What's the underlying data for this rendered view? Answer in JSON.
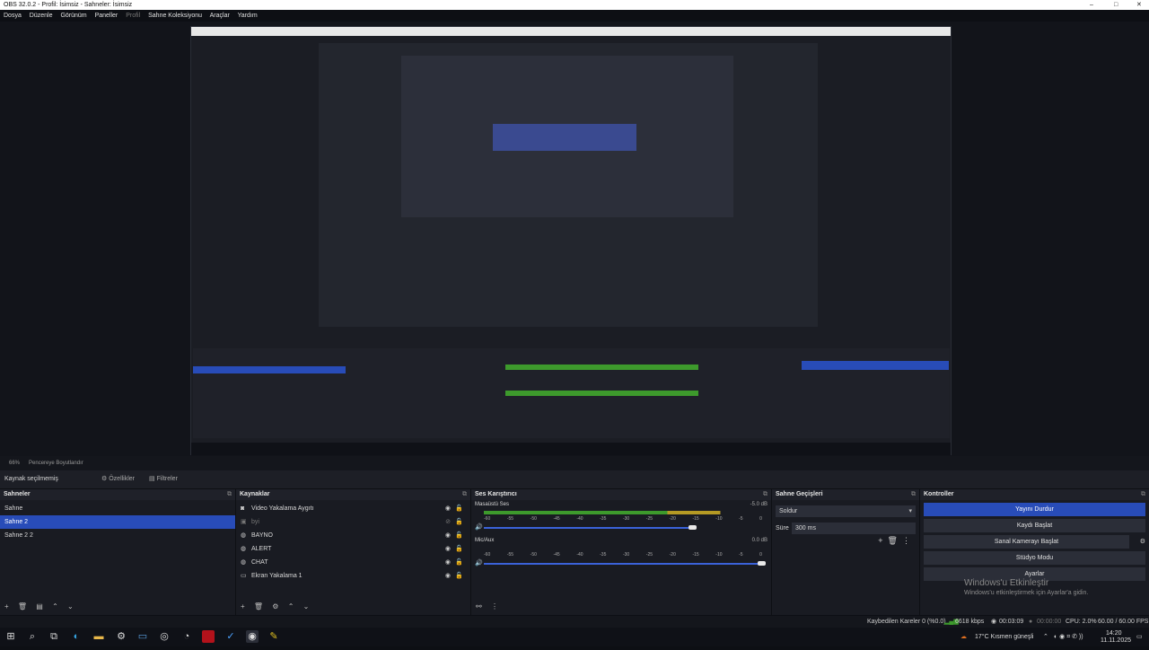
{
  "window": {
    "title": "OBS 32.0.2 - Profil: İsimsiz - Sahneler: İsimsiz",
    "controls": [
      "–",
      "□",
      "✕"
    ]
  },
  "menu": [
    "Dosya",
    "Düzenle",
    "Görünüm",
    "Paneller",
    "Profil",
    "Sahne Koleksiyonu",
    "Araçlar",
    "Yardım"
  ],
  "status_row": {
    "zoom": "66%",
    "mode": "Pencereye Boyutlandır"
  },
  "source_bar": {
    "selected": "Kaynak seçilmemiş",
    "properties": "Özellikler",
    "filters": "Filtreler"
  },
  "scenes": {
    "title": "Sahneler",
    "items": [
      "Sahne",
      "Sahne 2",
      "Sahne 2 2"
    ],
    "selected_index": 1,
    "footer_icons": [
      "+",
      "🗑",
      "▤",
      "⌃",
      "⌄"
    ]
  },
  "sources": {
    "title": "Kaynaklar",
    "items": [
      {
        "label": "Video Yakalama Aygıtı",
        "icon": "camera-icon",
        "visible": true
      },
      {
        "label": "byi",
        "icon": "image-icon",
        "visible": false
      },
      {
        "label": "BAYNO",
        "icon": "browser-icon",
        "visible": true
      },
      {
        "label": "ALERT",
        "icon": "browser-icon",
        "visible": true
      },
      {
        "label": "CHAT",
        "icon": "browser-icon",
        "visible": true
      },
      {
        "label": "Ekran Yakalama 1",
        "icon": "monitor-icon",
        "visible": true
      }
    ],
    "footer_icons": [
      "+",
      "🗑",
      "⚙",
      "⌃",
      "⌄"
    ]
  },
  "mixer": {
    "title": "Ses Karıştırıcı",
    "tracks": [
      {
        "name": "Masaüstü Ses",
        "db": "-5.0 dB",
        "level": 0.85,
        "volume": 0.75
      },
      {
        "name": "Mic/Aux",
        "db": "0.0 dB",
        "level": 0.0,
        "volume": 1.0
      }
    ],
    "ticks": [
      "-60",
      "-55",
      "-50",
      "-45",
      "-40",
      "-35",
      "-30",
      "-25",
      "-20",
      "-15",
      "-10",
      "-5",
      "0"
    ]
  },
  "transitions": {
    "title": "Sahne Geçişleri",
    "selected": "Soldur",
    "duration_label": "Süre",
    "duration_value": "300 ms"
  },
  "controls": {
    "title": "Kontroller",
    "buttons": [
      "Yayını Durdur",
      "Kaydı Başlat",
      "Sanal Kamerayı Başlat",
      "Stüdyo Modu",
      "Ayarlar"
    ]
  },
  "watermark": {
    "line1": "Windows'u Etkinleştir",
    "line2": "Windows'u etkinleştirmek için Ayarlar'a gidin."
  },
  "stats": {
    "dropped": "Kaybedilen Kareler 0 (%0.0)",
    "bitrate": "6618 kbps",
    "stream_time": "00:03:09",
    "rec_time": "00:00:00",
    "cpu": "CPU: 2.0%",
    "fps": "60.00 / 60.00 FPS"
  },
  "taskbar": {
    "weather": "17°C  Kısmen güneşli",
    "time": "14:20",
    "date": "11.11.2025"
  },
  "colors": {
    "accent": "#284cb8",
    "bg": "#191b22"
  }
}
